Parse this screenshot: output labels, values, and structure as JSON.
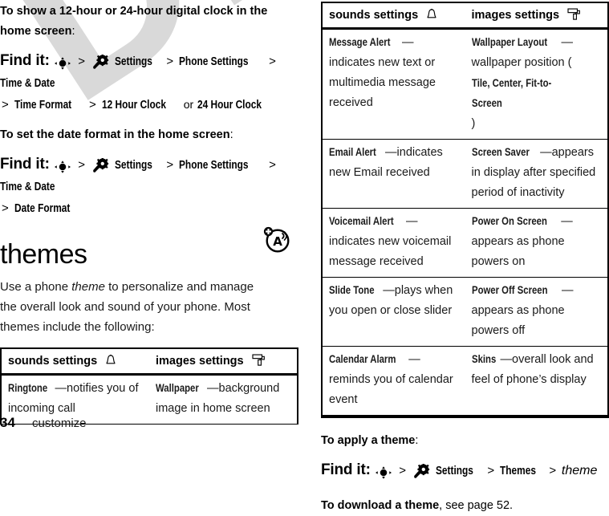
{
  "watermark": {
    "text": "DRAFT"
  },
  "left_column": {
    "instruction_1": {
      "lead_bold": "To show a 12-hour or 24-hour digital clock in the",
      "lead_bold_2": "home screen",
      "lead_colon": ":",
      "findit_label": "Find it:",
      "nav_icon": "navigation-key-icon",
      "gear_icon": "settings-gear-icon",
      "path": [
        "Settings",
        "Phone Settings",
        "Time & Date",
        "Time Format",
        "12 Hour Clock"
      ],
      "or_word": "or",
      "path_alt": "24 Hour Clock",
      "separator": ">"
    },
    "instruction_2": {
      "lead_bold": "To set the date format in the home screen",
      "lead_colon": ":",
      "findit_label": "Find it:",
      "nav_icon": "navigation-key-icon",
      "gear_icon": "settings-gear-icon",
      "path": [
        "Settings",
        "Phone Settings",
        "Time & Date",
        "Date Format"
      ],
      "separator": ">"
    },
    "chapter_heading": "themes",
    "intro_paragraph_parts": {
      "before_italic": "Use a phone ",
      "italic": "theme",
      "after_italic": " to personalize and manage the overall look and sound of your phone. Most themes include the following:"
    },
    "notice_icon": "audio-plus-notice-icon",
    "table": {
      "headers": [
        {
          "label": "sounds settings",
          "icon": "bell-icon"
        },
        {
          "label": "images settings",
          "icon": "paint-roller-icon"
        }
      ],
      "rows": [
        {
          "sounds_term": "Ringtone",
          "sounds_desc": "—notifies you of incoming call",
          "images_term": "Wallpaper",
          "images_desc": "—background image in home screen"
        }
      ]
    }
  },
  "right_column": {
    "table": {
      "headers": [
        {
          "label": "sounds settings",
          "icon": "bell-icon"
        },
        {
          "label": "images settings",
          "icon": "paint-roller-icon"
        }
      ],
      "rows": [
        {
          "sounds_term": "Message Alert",
          "sounds_desc": "—indicates new text or multimedia message received",
          "images_term": "Wallpaper Layout",
          "images_desc_pre": "—wallpaper position (",
          "images_desc_bold": "Tile, Center, Fit-to-Screen",
          "images_desc_post": ")"
        },
        {
          "sounds_term": "Email Alert",
          "sounds_desc": "—indicates new Email received",
          "images_term": "Screen Saver",
          "images_desc": "—appears in display after specified period of inactivity"
        },
        {
          "sounds_term": "Voicemail Alert",
          "sounds_desc": "—indicates new voicemail message received",
          "images_term": "Power On Screen",
          "images_desc": "—appears as phone powers on"
        },
        {
          "sounds_term": "Slide Tone",
          "sounds_desc": "—plays when you open or close slider",
          "images_term": "Power Off Screen",
          "images_desc": "—appears as phone powers off"
        },
        {
          "sounds_term": "Calendar Alarm",
          "sounds_desc": "—reminds you of calendar event",
          "images_term": "Skins",
          "images_desc": "—overall look and feel of phone’s display"
        }
      ]
    },
    "instruction_3": {
      "lead_bold": "To apply a theme",
      "lead_colon": ":",
      "findit_label": "Find it:",
      "nav_icon": "navigation-key-icon",
      "gear_icon": "settings-gear-icon",
      "path": [
        "Settings",
        "Themes"
      ],
      "italic_target": "theme",
      "separator": ">"
    },
    "download_note": {
      "bold": "To download a theme",
      "rest": ", see page 52."
    }
  },
  "footer": {
    "page_number": "34",
    "chapter_tag": "customize"
  }
}
